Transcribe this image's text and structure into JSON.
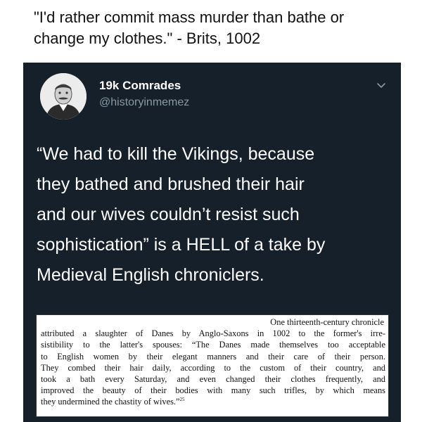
{
  "caption": {
    "line1": "\"I'd rather commit mass murder than bathe or",
    "line2": "change my clothes.\" - Brits, 1002"
  },
  "tweet": {
    "display_name": "19k Comrades",
    "handle": "@historyinmemez",
    "avatar_icon": "avatar-portrait",
    "menu_icon": "chevron-down-icon",
    "text_lines": [
      "“We had to kill the Vikings, because",
      "they bathed and brushed their hair",
      "and our wives couldn’t resist such",
      "sophistication” is a HELL of a take by",
      "Medieval English chroniclers."
    ]
  },
  "quote_excerpt": {
    "lines": [
      "One thirteenth-century chronicle",
      "attributed a slaughter of Danes by Anglo-Saxons in 1002 to the former's irre-",
      "sistibility to the latter's spouses: “The Danes made themselves too acceptable",
      "to English women by their elegant manners and their care of their person.",
      "They combed their hair daily, according to the custom of their country, and",
      "took a bath every Saturday, and even changed their clothes frequently, and",
      "improved the beauty of their bodies with many such trifles, by which means",
      "they undermined the chastity of wives.”"
    ],
    "footnote": "25"
  },
  "colors": {
    "tweet_background": "#15202b",
    "name_text": "#ffffff",
    "handle_text": "#8899a6"
  }
}
